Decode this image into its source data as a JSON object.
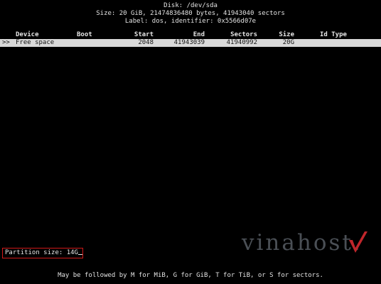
{
  "header": {
    "disk_line": "Disk: /dev/sda",
    "size_line": "Size: 20 GiB, 21474836480 bytes, 41943040 sectors",
    "label_line": "Label: dos, identifier: 0x5566d07e"
  },
  "table": {
    "columns": {
      "device": "Device",
      "boot": "Boot",
      "start": "Start",
      "end": "End",
      "sectors": "Sectors",
      "size": "Size",
      "id_type": "Id Type"
    },
    "rows": [
      {
        "pointer": ">>",
        "device": "Free space",
        "boot": "",
        "start": "2048",
        "end": "41943039",
        "sectors": "41940992",
        "size": "20G",
        "id_type": ""
      }
    ]
  },
  "prompt": {
    "label": "Partition size:",
    "value": "14G"
  },
  "watermark": {
    "text": "vinahost.",
    "icon": "checkmark-logo-icon",
    "color": "#4a4f55",
    "accent": "#c0262b"
  },
  "footer": {
    "hint": "May be followed by M for MiB, G for GiB, T for TiB, or S for sectors."
  },
  "colors": {
    "background": "#000000",
    "text": "#d8d8d8",
    "selection": "#d9d9d9",
    "highlight_border": "#d01818"
  }
}
